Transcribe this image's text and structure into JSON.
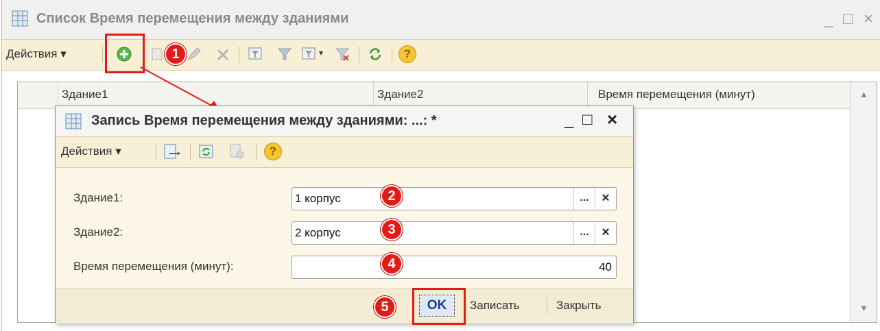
{
  "main_window": {
    "title": "Список Время перемещения между зданиями",
    "minimize": "_",
    "maximize": "□",
    "close": "×",
    "toolbar": {
      "actions_label": "Действия ▾",
      "help": "?"
    },
    "grid": {
      "columns": [
        "Здание1",
        "Здание2",
        "Время перемещения (минут)"
      ]
    }
  },
  "dialog": {
    "title": "Запись Время перемещения между зданиями: ...: *",
    "minimize": "_",
    "maximize": "□",
    "close": "×",
    "toolbar": {
      "actions_label": "Действия ▾",
      "help": "?"
    },
    "fields": {
      "building1": {
        "label": "Здание1:",
        "value": "1 корпус",
        "choose": "...",
        "clear": "×"
      },
      "building2": {
        "label": "Здание2:",
        "value": "2 корпус",
        "choose": "...",
        "clear": "×"
      },
      "travel_time": {
        "label": "Время перемещения (минут):",
        "value": "40"
      }
    },
    "footer": {
      "ok": "OK",
      "save": "Записать",
      "close": "Закрыть"
    }
  },
  "badges": [
    "1",
    "2",
    "3",
    "4",
    "5"
  ],
  "colors": {
    "accent_red": "#e31b17",
    "toolbar_bg": "#f7efd6",
    "add_green": "#4caf3d"
  }
}
